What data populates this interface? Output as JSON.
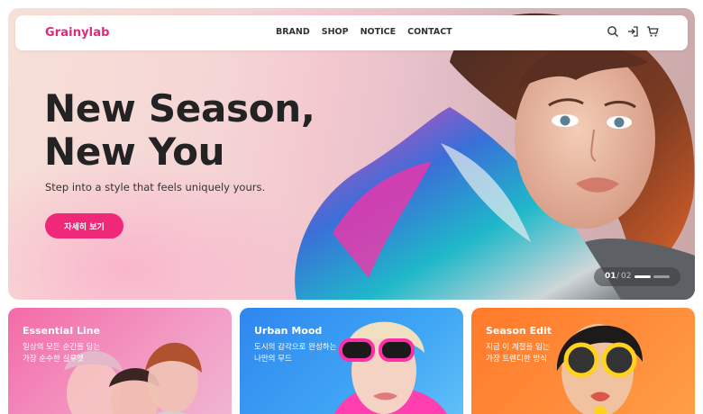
{
  "nav": {
    "logo": "Grainylab",
    "menu": [
      "BRAND",
      "SHOP",
      "NOTICE",
      "CONTACT"
    ],
    "icons": [
      "search-icon",
      "login-icon",
      "cart-icon"
    ]
  },
  "hero": {
    "headline_line1": "New Season,",
    "headline_line2": "New You",
    "subline": "Step into a style that feels uniquely yours.",
    "cta_label": "자세히 보기",
    "slider": {
      "current": "01",
      "separator": "/",
      "total": "02"
    }
  },
  "cards": [
    {
      "title": "Essential Line",
      "desc_line1": "일상의 모든 순간을 담는",
      "desc_line2": "가장 순수한 실루엣"
    },
    {
      "title": "Urban Mood",
      "desc_line1": "도시의 감각으로 완성하는",
      "desc_line2": "나만의 무드"
    },
    {
      "title": "Season Edit",
      "desc_line1": "지금 이 계절을 입는",
      "desc_line2": "가장 트렌디한 방식"
    }
  ],
  "colors": {
    "brand": "#e0287d",
    "cta": "#f0287a",
    "card1": "#f46aa8",
    "card2": "#2f86ef",
    "card3": "#ff7a2a"
  }
}
